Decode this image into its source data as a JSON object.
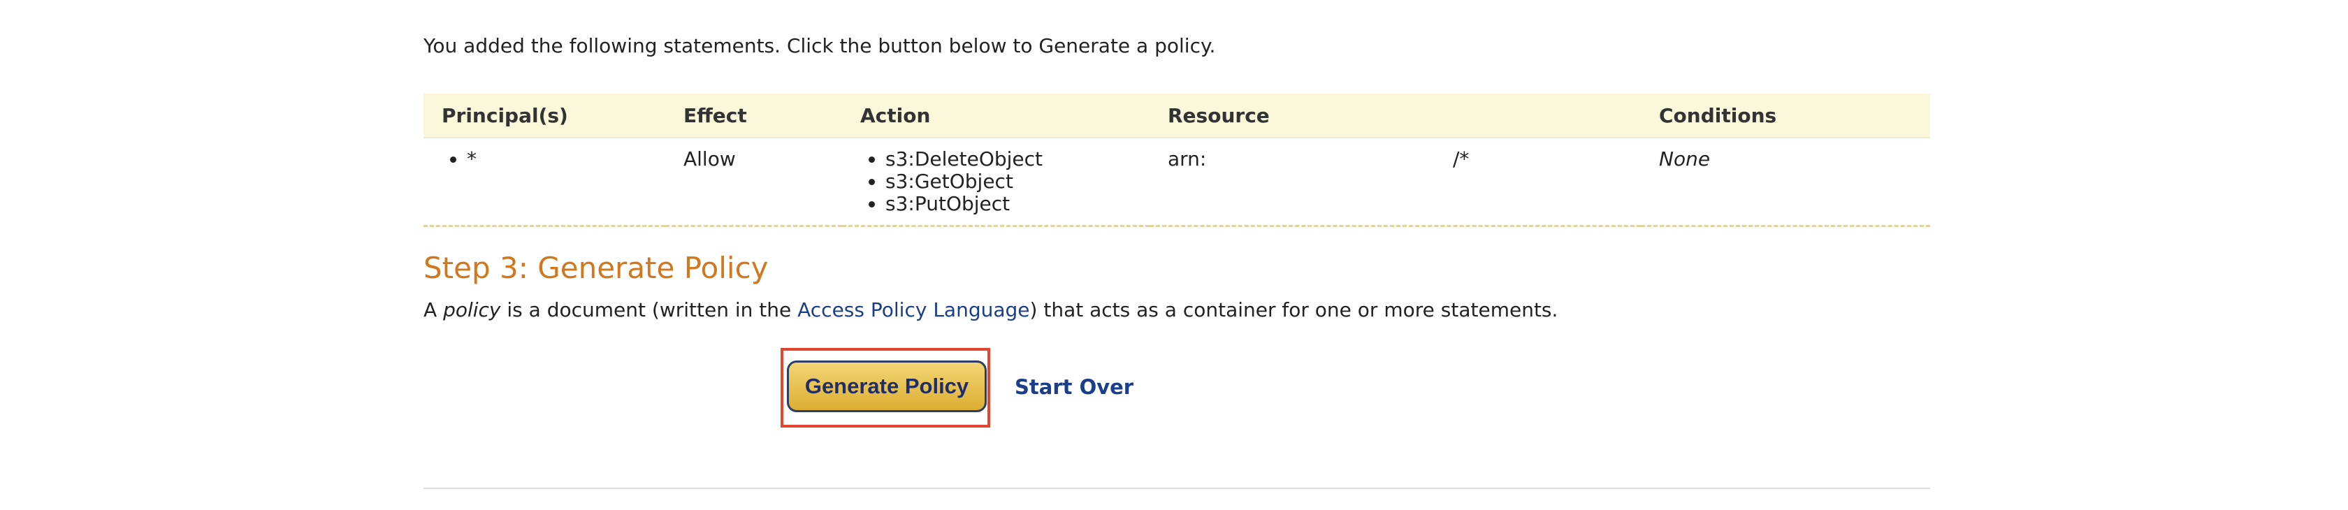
{
  "intro_text": "You added the following statements. Click the button below to Generate a policy.",
  "table": {
    "headers": {
      "principal": "Principal(s)",
      "effect": "Effect",
      "action": "Action",
      "resource": "Resource",
      "conditions": "Conditions"
    },
    "rows": [
      {
        "principals": [
          "*"
        ],
        "effect": "Allow",
        "actions": [
          "s3:DeleteObject",
          "s3:GetObject",
          "s3:PutObject"
        ],
        "resource_prefix": "arn:",
        "resource_suffix": "/*",
        "conditions": "None"
      }
    ]
  },
  "step3": {
    "title": "Step 3: Generate Policy",
    "desc_a": "A ",
    "desc_policy": "policy",
    "desc_mid": " is a document (written in the ",
    "desc_link": "Access Policy Language",
    "desc_end": ") that acts as a container for one or more statements."
  },
  "buttons": {
    "generate_label": "Generate Policy",
    "start_over_label": "Start Over"
  },
  "colors": {
    "step_title": "#d1781f",
    "link": "#1a3e8a",
    "table_header_bg": "#fbf7da",
    "highlight": "#e0462f",
    "button_gold": "#dcae32"
  }
}
